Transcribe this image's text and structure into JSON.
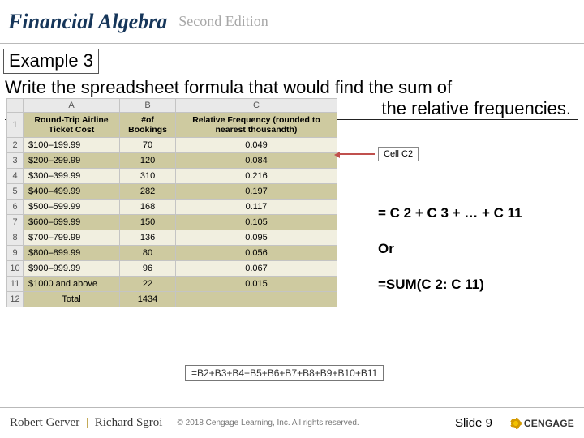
{
  "header": {
    "brand_a": "Financial",
    "brand_b": "Algebra",
    "edition": "Second Edition"
  },
  "example_label": "Example 3",
  "prompt_line1": "Write the spreadsheet formula that would find the sum of",
  "prompt_line2": "the relative frequencies.",
  "callout_label": "Cell C2",
  "table": {
    "cols": [
      "A",
      "B",
      "C"
    ],
    "header_cells": [
      "Round-Trip Airline Ticket Cost",
      "#of Bookings",
      "Relative Frequency (rounded to nearest thousandth)"
    ],
    "rows": [
      {
        "n": "2",
        "a": "$100–199.99",
        "b": "70",
        "c": "0.049"
      },
      {
        "n": "3",
        "a": "$200–299.99",
        "b": "120",
        "c": "0.084"
      },
      {
        "n": "4",
        "a": "$300–399.99",
        "b": "310",
        "c": "0.216"
      },
      {
        "n": "5",
        "a": "$400–499.99",
        "b": "282",
        "c": "0.197"
      },
      {
        "n": "6",
        "a": "$500–599.99",
        "b": "168",
        "c": "0.117"
      },
      {
        "n": "7",
        "a": "$600–699.99",
        "b": "150",
        "c": "0.105"
      },
      {
        "n": "8",
        "a": "$700–799.99",
        "b": "136",
        "c": "0.095"
      },
      {
        "n": "9",
        "a": "$800–899.99",
        "b": "80",
        "c": "0.056"
      },
      {
        "n": "10",
        "a": "$900–999.99",
        "b": "96",
        "c": "0.067"
      },
      {
        "n": "11",
        "a": "$1000 and above",
        "b": "22",
        "c": "0.015"
      }
    ],
    "total": {
      "n": "12",
      "a": "Total",
      "b": "1434",
      "c": ""
    }
  },
  "answers": {
    "line1": "= C 2 + C 3 + … + C 11",
    "line2": "Or",
    "line3": "=SUM(C 2: C 11)"
  },
  "formula_b12": "=B2+B3+B4+B5+B6+B7+B8+B9+B10+B11",
  "footer": {
    "author1": "Robert Gerver",
    "sep": "|",
    "author2": "Richard Sgroi",
    "copyright": "© 2018 Cengage Learning, Inc. All rights reserved.",
    "slide": "Slide 9",
    "publisher": "CENGAGE"
  },
  "chart_data": {
    "type": "table",
    "title": "Relative frequency of round-trip airline ticket bookings",
    "columns": [
      "Round-Trip Airline Ticket Cost",
      "# of Bookings",
      "Relative Frequency"
    ],
    "rows": [
      [
        "$100–199.99",
        70,
        0.049
      ],
      [
        "$200–299.99",
        120,
        0.084
      ],
      [
        "$300–399.99",
        310,
        0.216
      ],
      [
        "$400–499.99",
        282,
        0.197
      ],
      [
        "$500–599.99",
        168,
        0.117
      ],
      [
        "$600–699.99",
        150,
        0.105
      ],
      [
        "$700–799.99",
        136,
        0.095
      ],
      [
        "$800–899.99",
        80,
        0.056
      ],
      [
        "$900–999.99",
        96,
        0.067
      ],
      [
        "$1000 and above",
        22,
        0.015
      ]
    ],
    "total_bookings": 1434
  }
}
